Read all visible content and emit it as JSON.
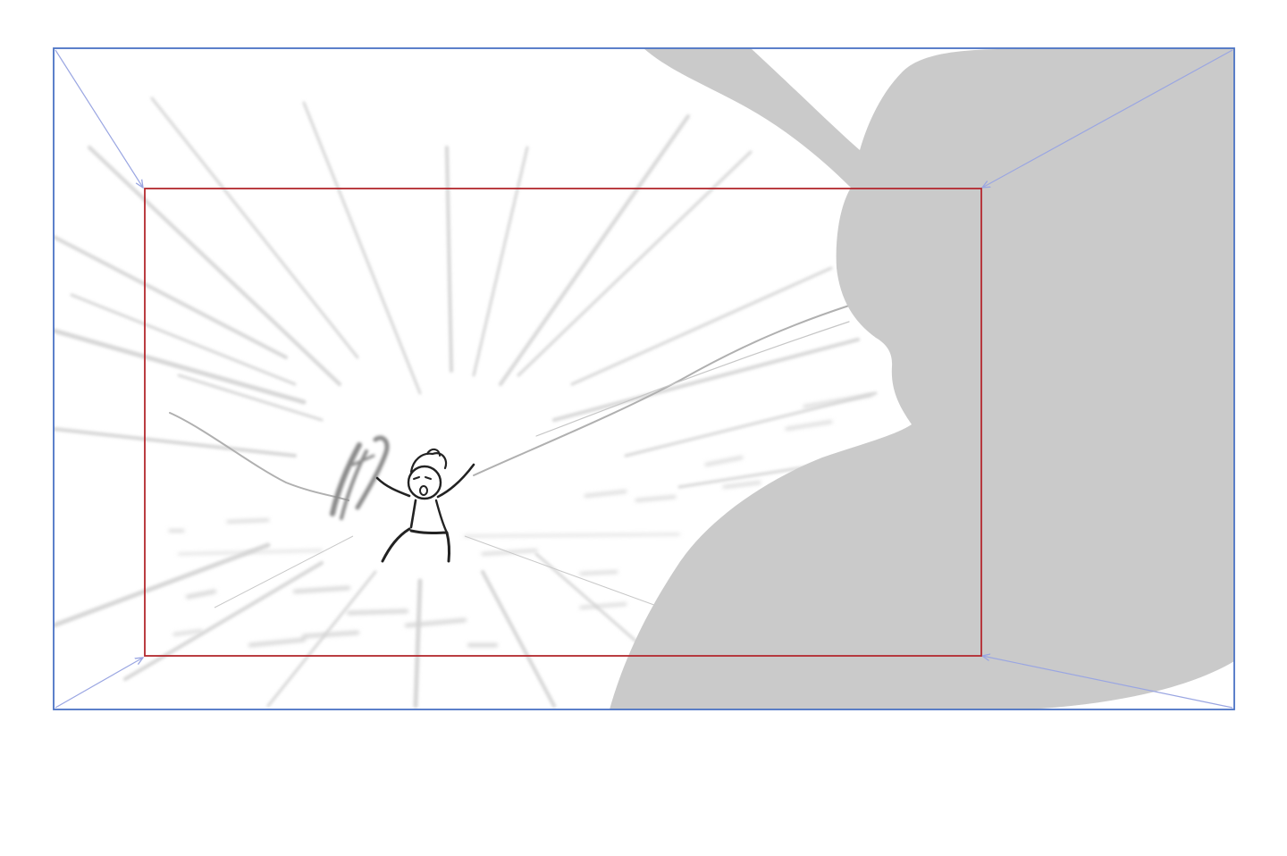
{
  "colors": {
    "background": "#ffffff",
    "outer_frame": "#4a72c4",
    "inner_frame": "#b3282e",
    "camera_move_arrows": "#9aa6e2",
    "foreground_silhouette": "#cacaca",
    "speed_lines": "#d6d6d6",
    "figure_ink": "#222222"
  },
  "board": {
    "panel": "storyboard-panel",
    "camera_move": "push-in",
    "start_frame": "outer-frame",
    "end_frame": "inner-frame",
    "arrow_icon": "arrow-icon",
    "silhouette_icon": "rabbit-silhouette-icon",
    "figure_icon": "stick-figure-icon",
    "shield_icon": "shield-icon"
  }
}
